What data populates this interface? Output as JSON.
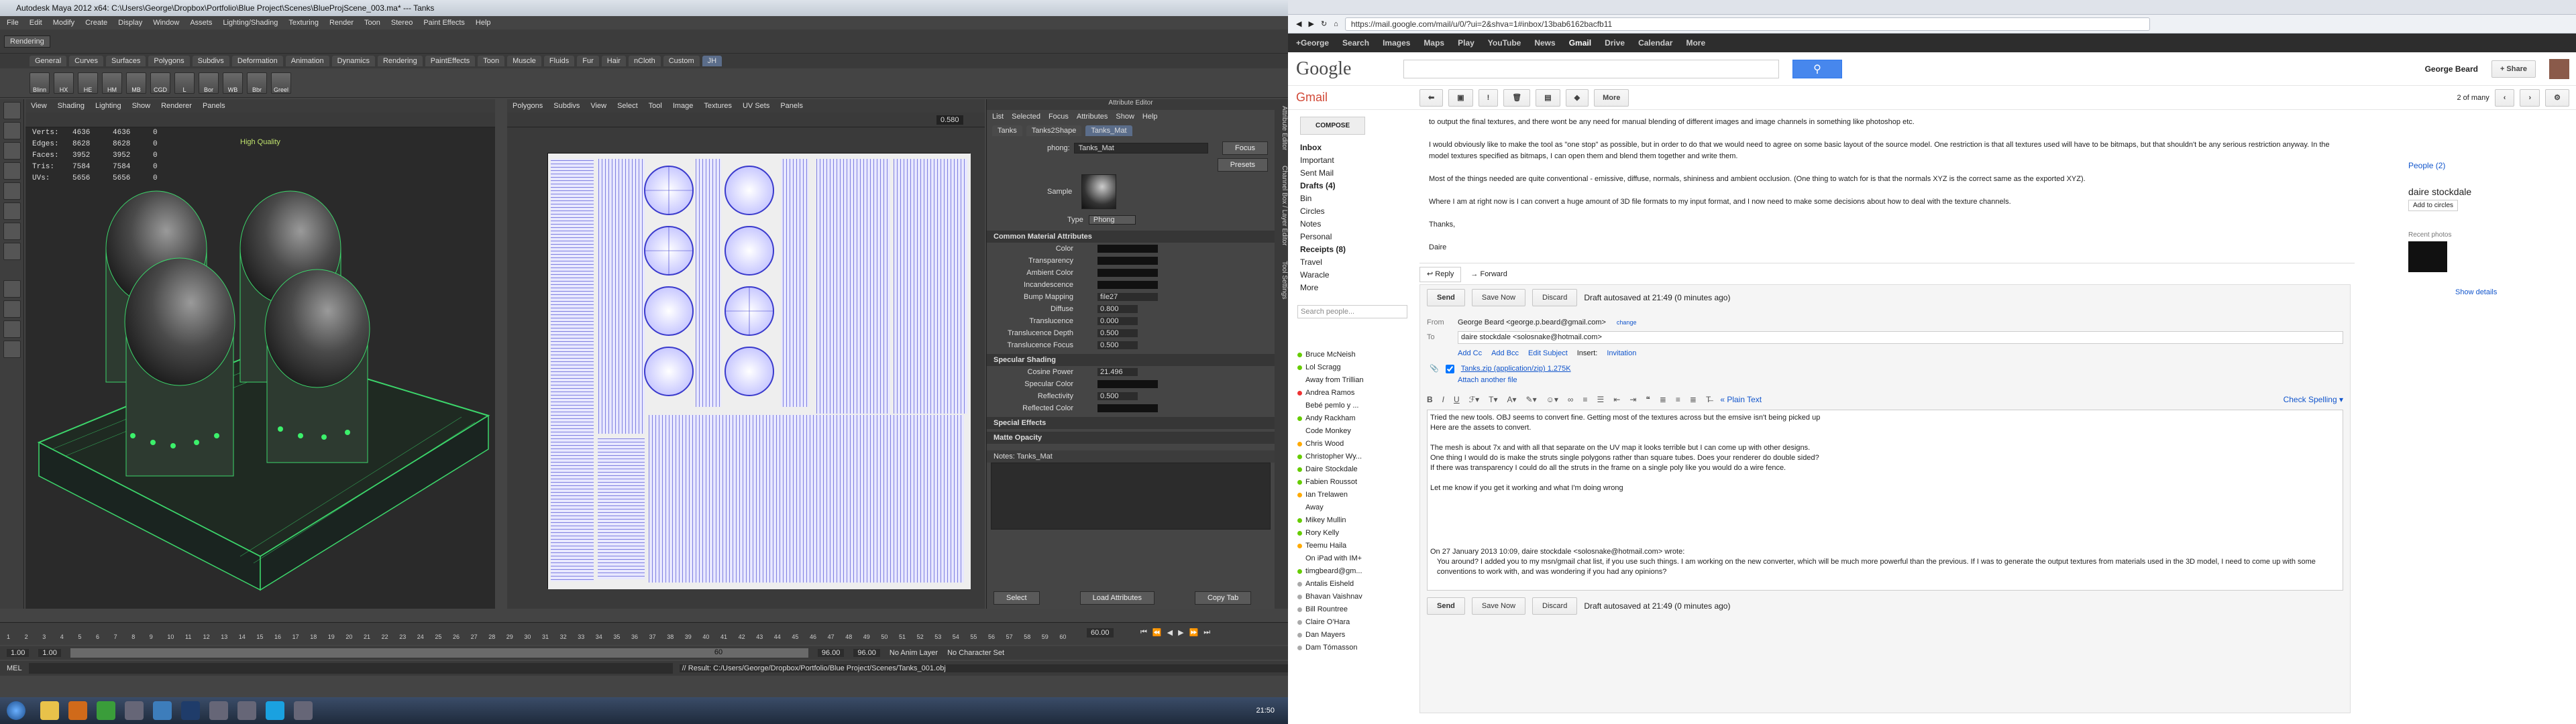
{
  "maya": {
    "title": "Autodesk Maya 2012 x64: C:\\Users\\George\\Dropbox\\Portfolio\\Blue Project\\Scenes\\BlueProjScene_003.ma* --- Tanks",
    "menus": [
      "File",
      "Edit",
      "Modify",
      "Create",
      "Display",
      "Window",
      "Assets",
      "Lighting/Shading",
      "Texturing",
      "Render",
      "Toon",
      "Stereo",
      "Paint Effects",
      "Help"
    ],
    "mode": "Rendering",
    "shelf_tabs": [
      "General",
      "Curves",
      "Surfaces",
      "Polygons",
      "Subdivs",
      "Deformation",
      "Animation",
      "Dynamics",
      "Rendering",
      "PaintEffects",
      "Toon",
      "Muscle",
      "Fluids",
      "Fur",
      "Hair",
      "nCloth",
      "Custom",
      "JH"
    ],
    "shelf_active": "JH",
    "shelf_icons": [
      "Blinn",
      "HX",
      "HE",
      "HM",
      "MB",
      "CGD",
      "L",
      "Bor",
      "WB",
      "Bbr",
      "Greel"
    ],
    "vp_menus": [
      "View",
      "Shading",
      "Lighting",
      "Show",
      "Renderer",
      "Panels"
    ],
    "hud": {
      "labels": [
        "Verts:",
        "Edges:",
        "Faces:",
        "Tris:",
        "UVs:"
      ],
      "v1": [
        "4636",
        "8628",
        "3952",
        "7584",
        "5656"
      ],
      "v2": [
        "4636",
        "8628",
        "3952",
        "7584",
        "5656"
      ],
      "v3": [
        "0",
        "0",
        "0",
        "0",
        "0"
      ],
      "quality": "High Quality"
    },
    "uv_menus": [
      "Polygons",
      "Subdivs",
      "View",
      "Select",
      "Tool",
      "Image",
      "Textures",
      "UV Sets",
      "Panels"
    ],
    "uv_value": "0.580",
    "ae": {
      "title": "Attribute Editor",
      "menus": [
        "List",
        "Selected",
        "Focus",
        "Attributes",
        "Show",
        "Help"
      ],
      "tabs": [
        "Tanks",
        "Tanks2Shape",
        "Tanks_Mat"
      ],
      "phong_label": "phong:",
      "phong_value": "Tanks_Mat",
      "focus": "Focus",
      "presets": "Presets",
      "sample": "Sample",
      "type_label": "Type",
      "type_value": "Phong",
      "common_section": "Common Material Attributes",
      "common_fields": [
        "Color",
        "Transparency",
        "Ambient Color",
        "Incandescence",
        "Bump Mapping",
        "Diffuse",
        "Translucence",
        "Translucence Depth",
        "Translucence Focus"
      ],
      "bump_value": "file27",
      "diffuse_value": "0.800",
      "transl_value": "0.000",
      "depth_value": "0.500",
      "focus_value": "0.500",
      "spec_section": "Specular Shading",
      "spec_fields": [
        "Cosine Power",
        "Specular Color",
        "Reflectivity",
        "Reflected Color"
      ],
      "cosine_value": "21.496",
      "reflect_value": "0.500",
      "special_section": "Special Effects",
      "matte_section": "Matte Opacity",
      "notes": "Notes: Tanks_Mat",
      "buttons": [
        "Select",
        "Load Attributes",
        "Copy Tab"
      ]
    },
    "side_tabs": [
      "Attribute Editor",
      "Channel Box / Layer Editor",
      "Tool Settings"
    ],
    "time": {
      "ticks": [
        "1",
        "2",
        "3",
        "4",
        "5",
        "6",
        "7",
        "8",
        "9",
        "10",
        "11",
        "12",
        "13",
        "14",
        "15",
        "16",
        "17",
        "18",
        "19",
        "20",
        "21",
        "22",
        "23",
        "24",
        "25",
        "26",
        "27",
        "28",
        "29",
        "30",
        "31",
        "32",
        "33",
        "34",
        "35",
        "36",
        "37",
        "38",
        "39",
        "40",
        "41",
        "42",
        "43",
        "44",
        "45",
        "46",
        "47",
        "48",
        "49",
        "50",
        "51",
        "52",
        "53",
        "54",
        "55",
        "56",
        "57",
        "58",
        "59",
        "60"
      ],
      "current": "60.00"
    },
    "range": {
      "start": "1.00",
      "start2": "1.00",
      "end": "96.00",
      "end2": "96.00",
      "anim_layer": "No Anim Layer",
      "char": "No Character Set",
      "marker": "60"
    },
    "cmd": {
      "label": "MEL",
      "result": "// Result: C:/Users/George/Dropbox/Portfolio/Blue Project/Scenes/Tanks_001.obj"
    }
  },
  "taskbar": {
    "clock": "21:50"
  },
  "gmail": {
    "url": "https://mail.google.com/mail/u/0/?ui=2&shva=1#inbox/13bab6162bacfb11",
    "nav": [
      "+George",
      "Search",
      "Images",
      "Maps",
      "Play",
      "YouTube",
      "News",
      "Gmail",
      "Drive",
      "Calendar",
      "More"
    ],
    "nav_active": "Gmail",
    "user": "George Beard",
    "share": "+ Share",
    "logo": "Google",
    "gmail_label": "Gmail",
    "more": "More",
    "pager": "2 of many",
    "compose": "COMPOSE",
    "labels": [
      "Inbox",
      "Important",
      "Sent Mail",
      "Drafts (4)",
      "Bin",
      "Circles",
      "Notes",
      "Personal",
      "Receipts (8)",
      "Travel",
      "Waracle",
      "More"
    ],
    "search_people": "Search people...",
    "chat": [
      {
        "n": "Bruce McNeish",
        "c": "#6c0"
      },
      {
        "n": "Lol Scragg",
        "c": "#6c0"
      },
      {
        "n": "Away from Trillian",
        "c": "#fff"
      },
      {
        "n": "Andrea Ramos",
        "c": "#e33"
      },
      {
        "n": "Bebé pemlo y ...",
        "c": "#fff"
      },
      {
        "n": "Andy Rackham",
        "c": "#6c0"
      },
      {
        "n": "Code Monkey",
        "c": "#fff"
      },
      {
        "n": "Chris Wood",
        "c": "#fa0"
      },
      {
        "n": "Christopher Wy...",
        "c": "#6c0"
      },
      {
        "n": "Daire Stockdale",
        "c": "#6c0"
      },
      {
        "n": "Fabien Roussot",
        "c": "#6c0"
      },
      {
        "n": "Ian Trelawen",
        "c": "#fa0"
      },
      {
        "n": "Away",
        "c": "#fff"
      },
      {
        "n": "Mikey Mullin",
        "c": "#6c0"
      },
      {
        "n": "Rory Kelly",
        "c": "#6c0"
      },
      {
        "n": "Teemu Haila",
        "c": "#fa0"
      },
      {
        "n": "On iPad with IM+",
        "c": "#fff"
      },
      {
        "n": "timgbeard@gm...",
        "c": "#6c0"
      },
      {
        "n": "Antalis Eisheld",
        "c": "#aaa"
      },
      {
        "n": "Bhavan Vaishnav",
        "c": "#aaa"
      },
      {
        "n": "Bill Rountree",
        "c": "#aaa"
      },
      {
        "n": "Claire O'Hara",
        "c": "#aaa"
      },
      {
        "n": "Dan Mayers",
        "c": "#aaa"
      },
      {
        "n": "Dam Tómasson",
        "c": "#aaa"
      }
    ],
    "body_top": [
      "to output the final textures, and there wont be any need for manual blending of different images and image channels in something like photoshop etc.",
      "I would obviously like to make the tool as \"one stop\" as possible, but in order to do that we would need to agree on some basic layout of the source model. One restriction is that all textures used will have to be bitmaps, but that shouldn't be any serious restriction anyway. In the model textures specified as bitmaps, I can open them and blend them together and write them.",
      "Most of the things needed are quite conventional - emissive, diffuse, normals, shininess and ambient occlusion. (One thing to watch for is that the normals XYZ is the correct same as the exported XYZ).",
      "Where I am at right now is I can convert a huge amount of 3D file formats to my input format, and I now need to make some decisions about how to deal with the texture channels.",
      "Thanks,",
      "Daire"
    ],
    "reply": "Reply",
    "forward": "Forward",
    "send": "Send",
    "save_now": "Save Now",
    "discard": "Discard",
    "draft_status": "Draft autosaved at 21:49 (0 minutes ago)",
    "from_label": "From",
    "from_value": "George Beard <george.p.beard@gmail.com>",
    "change": "change",
    "to_label": "To",
    "to_value": "daire stockdale <solosnake@hotmail.com>",
    "add_links": [
      "Add Cc",
      "Add Bcc",
      "Edit Subject"
    ],
    "insert": "Insert:",
    "invitation": "Invitation",
    "attachment": "Tanks.zip (application/zip) 1.275K",
    "attach_another": "Attach another file",
    "plain_text": "« Plain Text",
    "check_spelling": "Check Spelling ▾",
    "compose_body": [
      "Tried the new tools. OBJ seems to convert fine. Getting most of the textures across but the emsive isn't being picked up",
      "Here are the assets to convert.",
      "",
      "The mesh is about 7x and with all that separate on the UV map it looks terrible but I can come up with other designs.",
      "One thing I would do is make the struts single polygons rather than square tubes. Does your renderer do double sided?",
      "If there was transparency I could do all the struts in the frame on a single poly like you would do a wire fence.",
      "",
      "Let me know if you get it working and what I'm doing wrong"
    ],
    "quote_head": "On 27 January 2013 10:09, daire stockdale <solosnake@hotmail.com> wrote:",
    "quote_body": "You around? I added you to my msn/gmail chat list, if you use such things. I am working on the new converter, which will be much more powerful than the previous. If I was to generate the output textures from materials used in the 3D model, I need to come up with some conventions to work with, and was wondering if you had any opinions?",
    "people": "People (2)",
    "person": "daire stockdale",
    "add_circles": "Add to circles",
    "recent_photos": "Recent photos",
    "show_details": "Show details"
  }
}
